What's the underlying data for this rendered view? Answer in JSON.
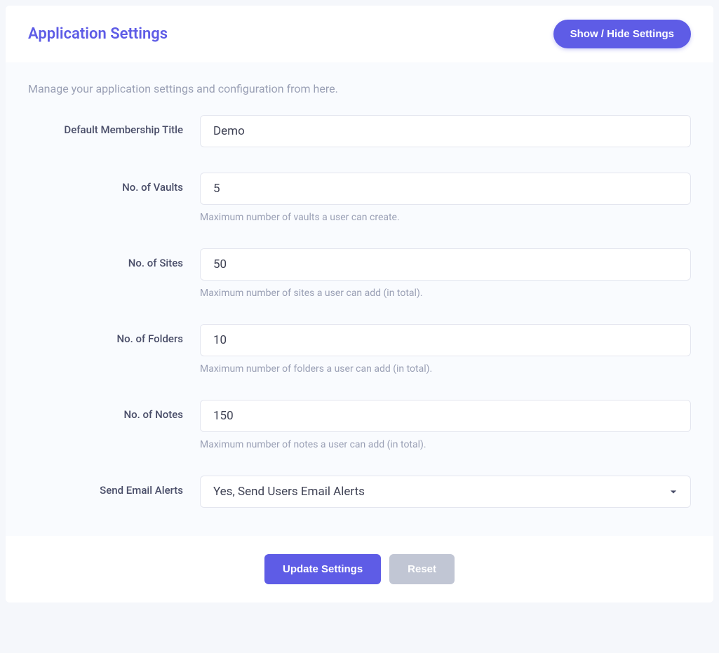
{
  "header": {
    "title": "Application Settings",
    "toggle_label": "Show / Hide Settings"
  },
  "body": {
    "description": "Manage your application settings and configuration from here.",
    "fields": {
      "membership_title": {
        "label": "Default Membership Title",
        "value": "Demo"
      },
      "vaults": {
        "label": "No. of Vaults",
        "value": "5",
        "help": "Maximum number of vaults a user can create."
      },
      "sites": {
        "label": "No. of Sites",
        "value": "50",
        "help": "Maximum number of sites a user can add (in total)."
      },
      "folders": {
        "label": "No. of Folders",
        "value": "10",
        "help": "Maximum number of folders a user can add (in total)."
      },
      "notes": {
        "label": "No. of Notes",
        "value": "150",
        "help": "Maximum number of notes a user can add (in total)."
      },
      "email_alerts": {
        "label": "Send Email Alerts",
        "selected": "Yes, Send Users Email Alerts"
      }
    }
  },
  "footer": {
    "update_label": "Update Settings",
    "reset_label": "Reset"
  }
}
